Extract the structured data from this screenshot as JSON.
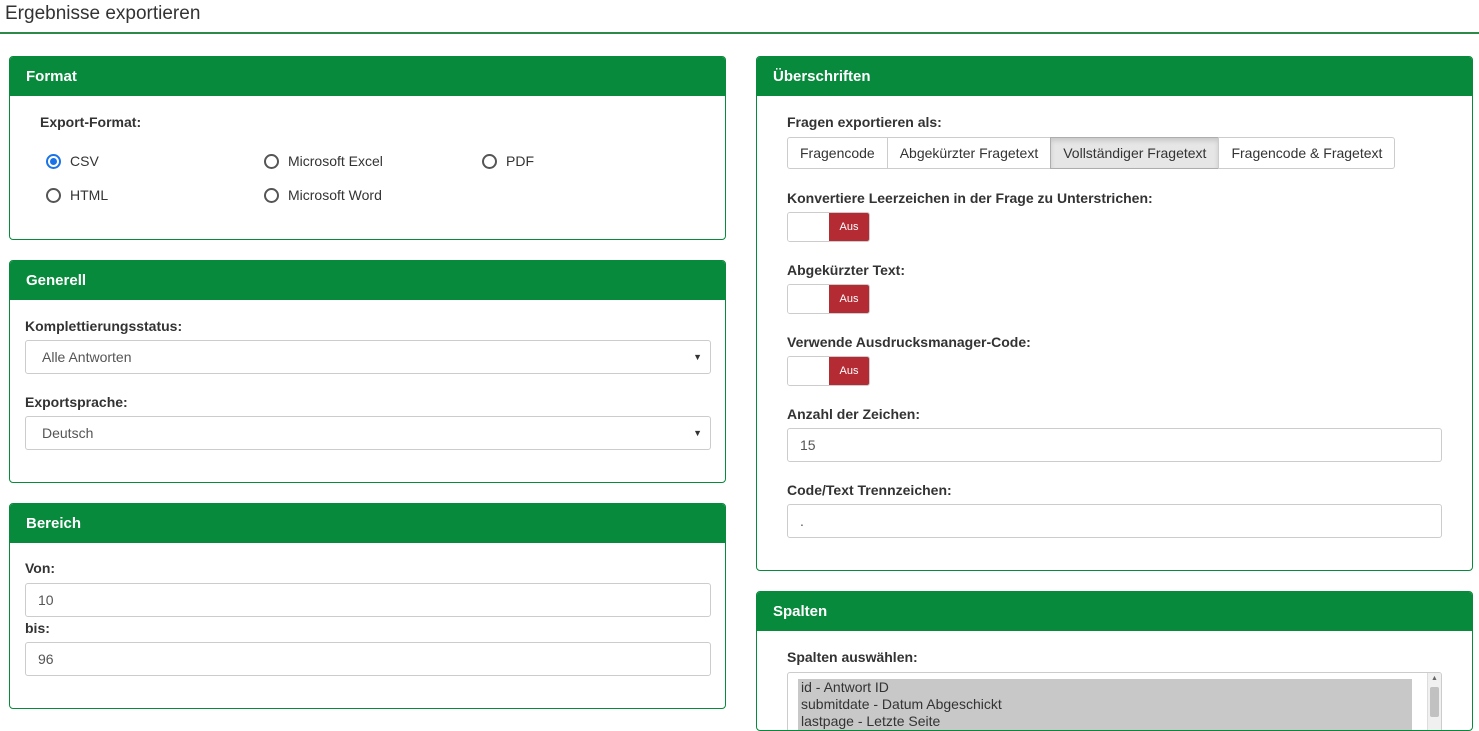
{
  "page": {
    "title": "Ergebnisse exportieren"
  },
  "format": {
    "heading": "Format",
    "export_label": "Export-Format:",
    "options": [
      "CSV",
      "Microsoft Excel",
      "PDF",
      "HTML",
      "Microsoft Word"
    ],
    "selected": "CSV"
  },
  "general": {
    "heading": "Generell",
    "status_label": "Komplettierungsstatus:",
    "status_value": "Alle Antworten",
    "language_label": "Exportsprache:",
    "language_value": "Deutsch"
  },
  "range": {
    "heading": "Bereich",
    "from_label": "Von:",
    "from_value": "10",
    "to_label": "bis:",
    "to_value": "96"
  },
  "headings": {
    "heading": "Überschriften",
    "questions_label": "Fragen exportieren als:",
    "question_modes": [
      "Fragencode",
      "Abgekürzter Fragetext",
      "Vollständiger Fragetext",
      "Fragencode & Fragetext"
    ],
    "active_mode": "Vollständiger Fragetext",
    "convert_spaces_label": "Konvertiere Leerzeichen in der Frage zu Unterstrichen:",
    "abbrev_label": "Abgekürzter Text:",
    "em_code_label": "Verwende Ausdrucksmanager-Code:",
    "toggle_off": "Aus",
    "char_count_label": "Anzahl der Zeichen:",
    "char_count_value": "15",
    "separator_label": "Code/Text Trennzeichen:",
    "separator_value": "."
  },
  "columns": {
    "heading": "Spalten",
    "select_label": "Spalten auswählen:",
    "items": [
      "id - Antwort ID",
      "submitdate - Datum Abgeschickt",
      "lastpage - Letzte Seite"
    ]
  },
  "colors": {
    "accent": "#088a3c",
    "toggle_off": "#b52b34",
    "radio": "#1a73e8"
  }
}
